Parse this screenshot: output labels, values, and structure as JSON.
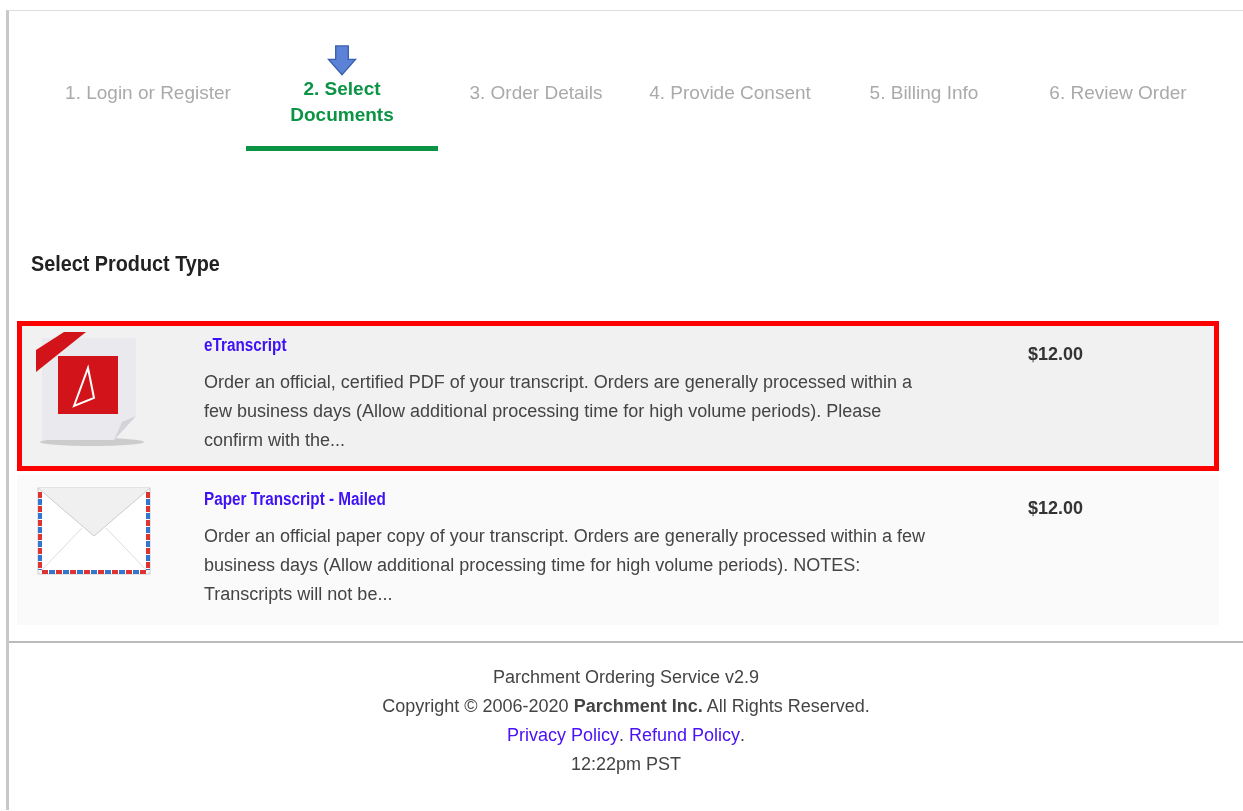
{
  "steps": [
    {
      "label": "1. Login or Register",
      "selected": false
    },
    {
      "label": "2. Select Documents",
      "selected": true
    },
    {
      "label": "3. Order Details",
      "selected": false
    },
    {
      "label": "4. Provide Consent",
      "selected": false
    },
    {
      "label": "5. Billing Info",
      "selected": false
    },
    {
      "label": "6. Review Order",
      "selected": false
    }
  ],
  "heading": "Select Product Type",
  "products": [
    {
      "kind": "pdf",
      "title": "eTranscript",
      "description": "Order an official, certified PDF of your transcript. Orders are generally processed within a few business days (Allow additional processing time for high volume periods). Please confirm with the...",
      "price": "$12.00",
      "highlighted": true
    },
    {
      "kind": "mail",
      "title": "Paper Transcript - Mailed",
      "description": "Order an official paper copy of your transcript. Orders are generally processed within a few business days (Allow additional processing time for high volume periods). NOTES: Transcripts will not be...",
      "price": "$12.00",
      "highlighted": false
    }
  ],
  "footer": {
    "version": "Parchment Ordering Service v2.9",
    "copyright": "Copyright © 2006-2020 **Parchment Inc.** All Rights Reserved.",
    "links": [
      {
        "label": "Privacy Policy",
        "suffix": "."
      },
      {
        "label": "Refund Policy",
        "suffix": "."
      }
    ],
    "time": "12:22pm PST"
  }
}
